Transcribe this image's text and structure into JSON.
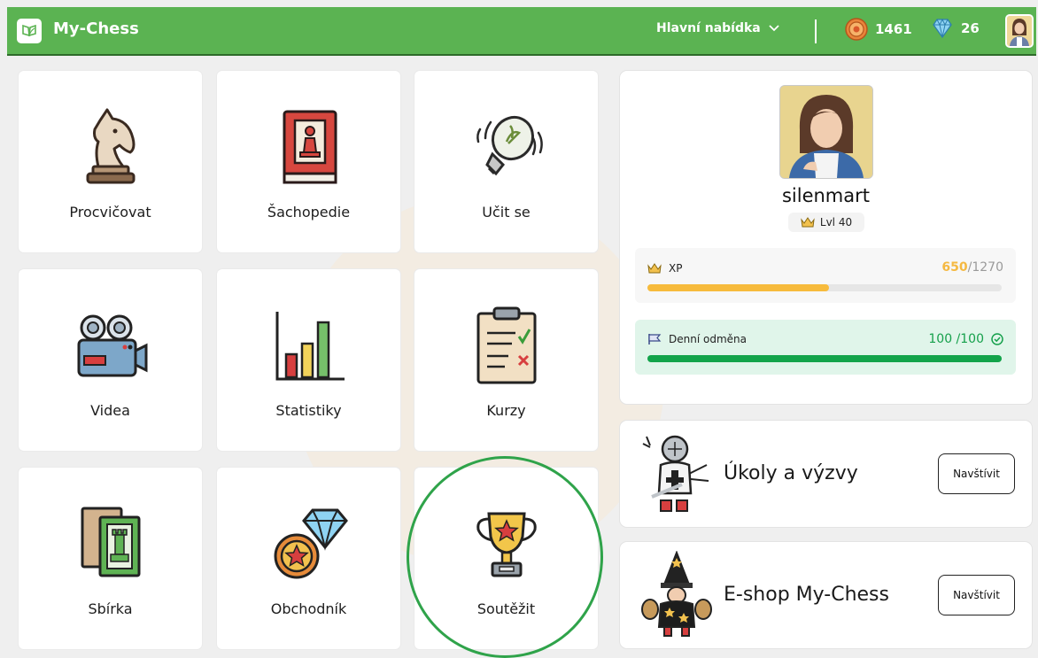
{
  "header": {
    "brand": "My-Chess",
    "menu_label": "Hlavní nabídka",
    "coins": "1461",
    "gems": "26"
  },
  "tiles": [
    {
      "label": "Procvičovat",
      "icon": "knight-icon"
    },
    {
      "label": "Šachopedie",
      "icon": "chess-book-icon"
    },
    {
      "label": "Učit se",
      "icon": "lightbulb-icon"
    },
    {
      "label": "Videa",
      "icon": "video-camera-icon"
    },
    {
      "label": "Statistiky",
      "icon": "bar-chart-icon"
    },
    {
      "label": "Kurzy",
      "icon": "clipboard-icon"
    },
    {
      "label": "Sbírka",
      "icon": "card-collection-icon"
    },
    {
      "label": "Obchodník",
      "icon": "coin-diamond-icon"
    },
    {
      "label": "Soutěžit",
      "icon": "trophy-icon"
    }
  ],
  "profile": {
    "username": "silenmart",
    "level": "Lvl 40",
    "xp_label": "XP",
    "xp_current": "650",
    "xp_max": "/1270",
    "xp_progress": 0.512,
    "daily_label": "Denní odměna",
    "daily_value": "100 /100",
    "daily_progress": 1.0
  },
  "promos": [
    {
      "title": "Úkoly a výzvy",
      "button": "Navštívit"
    },
    {
      "title": "E-shop My-Chess",
      "button": "Navštívit"
    }
  ],
  "colors": {
    "topbar": "#5bb352",
    "xp_bar": "#f7bb3c",
    "daily_bar": "#12a44a",
    "highlight": "#2fa34a"
  }
}
